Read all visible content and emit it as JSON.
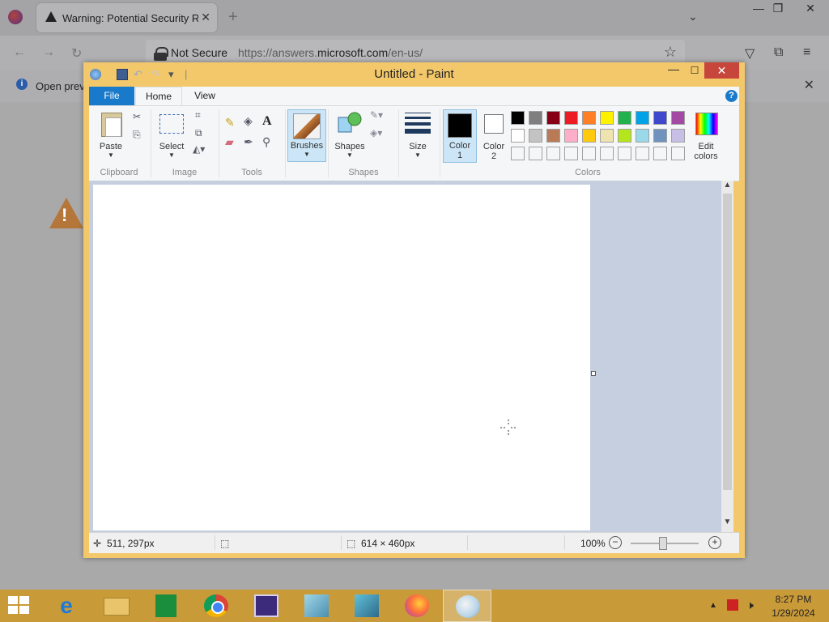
{
  "browser": {
    "tab_title": "Warning: Potential Security Risk",
    "url_security": "Not Secure",
    "url_prefix": "https://answers.",
    "url_domain": "microsoft.com",
    "url_suffix": "/en-us/",
    "info_text": "Open previ",
    "window_min": "—",
    "window_max": "❐",
    "window_close": "✕"
  },
  "paint": {
    "title": "Untitled - Paint",
    "tabs": {
      "file": "File",
      "home": "Home",
      "view": "View"
    },
    "groups": {
      "clipboard": "Clipboard",
      "image": "Image",
      "tools": "Tools",
      "shapes": "Shapes",
      "colors": "Colors"
    },
    "buttons": {
      "paste": "Paste",
      "select": "Select",
      "brushes": "Brushes",
      "shapes": "Shapes",
      "size": "Size",
      "color1_a": "Color",
      "color1_b": "1",
      "color2_a": "Color",
      "color2_b": "2",
      "edit_colors_a": "Edit",
      "edit_colors_b": "colors"
    },
    "palette": [
      [
        "#000000",
        "#7f7f7f",
        "#880015",
        "#ed1c24",
        "#ff7f27",
        "#fff200",
        "#22b14c",
        "#00a2e8",
        "#3f48cc",
        "#a349a4"
      ],
      [
        "#ffffff",
        "#c3c3c3",
        "#b97a57",
        "#ffaec9",
        "#ffc90e",
        "#efe4b0",
        "#b5e61d",
        "#99d9ea",
        "#7092be",
        "#c8bfe7"
      ],
      [
        "#f5f6f7",
        "#f5f6f7",
        "#f5f6f7",
        "#f5f6f7",
        "#f5f6f7",
        "#f5f6f7",
        "#f5f6f7",
        "#f5f6f7",
        "#f5f6f7",
        "#f5f6f7"
      ]
    ],
    "status": {
      "cursor_pos": "511, 297px",
      "image_size": "614 × 460px",
      "zoom": "100%"
    }
  },
  "taskbar": {
    "time": "8:27 PM",
    "date": "1/29/2024"
  }
}
